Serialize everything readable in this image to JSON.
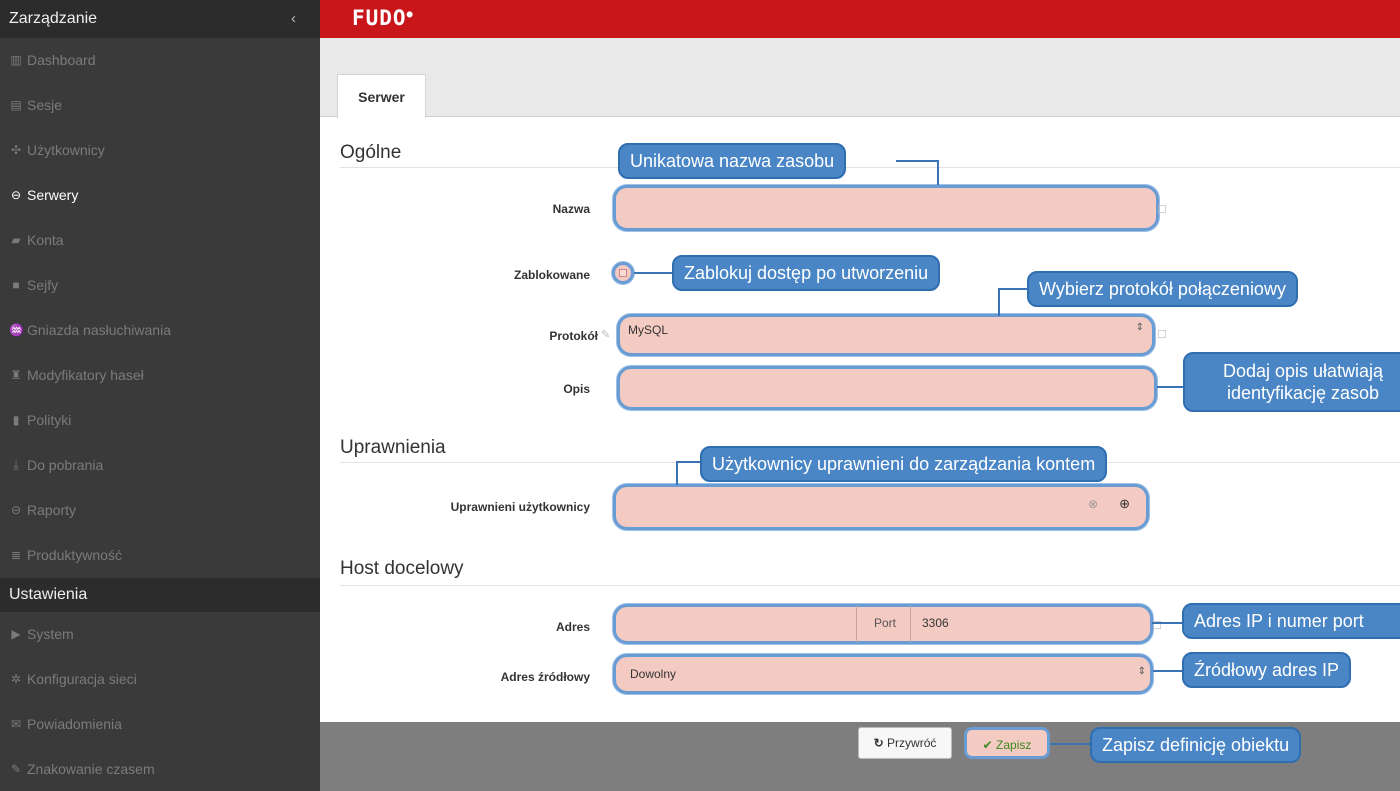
{
  "sidebar": {
    "header": "Zarządzanie",
    "items": [
      {
        "label": "Dashboard",
        "icon": "▥"
      },
      {
        "label": "Sesje",
        "icon": "▤"
      },
      {
        "label": "Użytkownicy",
        "icon": "✣"
      },
      {
        "label": "Serwery",
        "icon": "⊖"
      },
      {
        "label": "Konta",
        "icon": "▰"
      },
      {
        "label": "Sejfy",
        "icon": "■"
      },
      {
        "label": "Gniazda nasłuchiwania",
        "icon": "♒"
      },
      {
        "label": "Modyfikatory haseł",
        "icon": "♜"
      },
      {
        "label": "Polityki",
        "icon": "▮"
      },
      {
        "label": "Do pobrania",
        "icon": "⤓"
      },
      {
        "label": "Raporty",
        "icon": "⊖"
      },
      {
        "label": "Produktywność",
        "icon": "≣"
      }
    ],
    "section2": "Ustawienia",
    "items2": [
      {
        "label": "System",
        "icon": "▶"
      },
      {
        "label": "Konfiguracja sieci",
        "icon": "✲"
      },
      {
        "label": "Powiadomienia",
        "icon": "✉"
      },
      {
        "label": "Znakowanie czasem",
        "icon": "✎"
      }
    ],
    "chevron": "‹"
  },
  "topbar": {
    "logo": "FUDO"
  },
  "tab": {
    "label": "Serwer"
  },
  "sections": {
    "general": "Ogólne",
    "permissions": "Uprawnienia",
    "target": "Host docelowy"
  },
  "labels": {
    "name": "Nazwa",
    "blocked": "Zablokowane",
    "protocol": "Protokół",
    "description": "Opis",
    "users": "Uprawnieni użytkownicy",
    "address": "Adres",
    "source": "Adres źródłowy"
  },
  "fields": {
    "protocol_value": "MySQL",
    "port_label": "Port",
    "port_value": "3306",
    "source_value": "Dowolny"
  },
  "callouts": {
    "name": "Unikatowa nazwa zasobu",
    "blocked": "Zablokuj dostęp po utworzeniu",
    "protocol": "Wybierz protokół połączeniowy",
    "desc_line1": "Dodaj opis ułatwiają",
    "desc_line2": "identyfikację zasob",
    "users": "Użytkownicy uprawnieni do zarządzania kontem",
    "address": "Adres IP i numer port",
    "source": "Źródłowy adres IP",
    "save": "Zapisz definicję obiektu"
  },
  "buttons": {
    "reset": "Przywróć",
    "save": "Zapisz"
  }
}
